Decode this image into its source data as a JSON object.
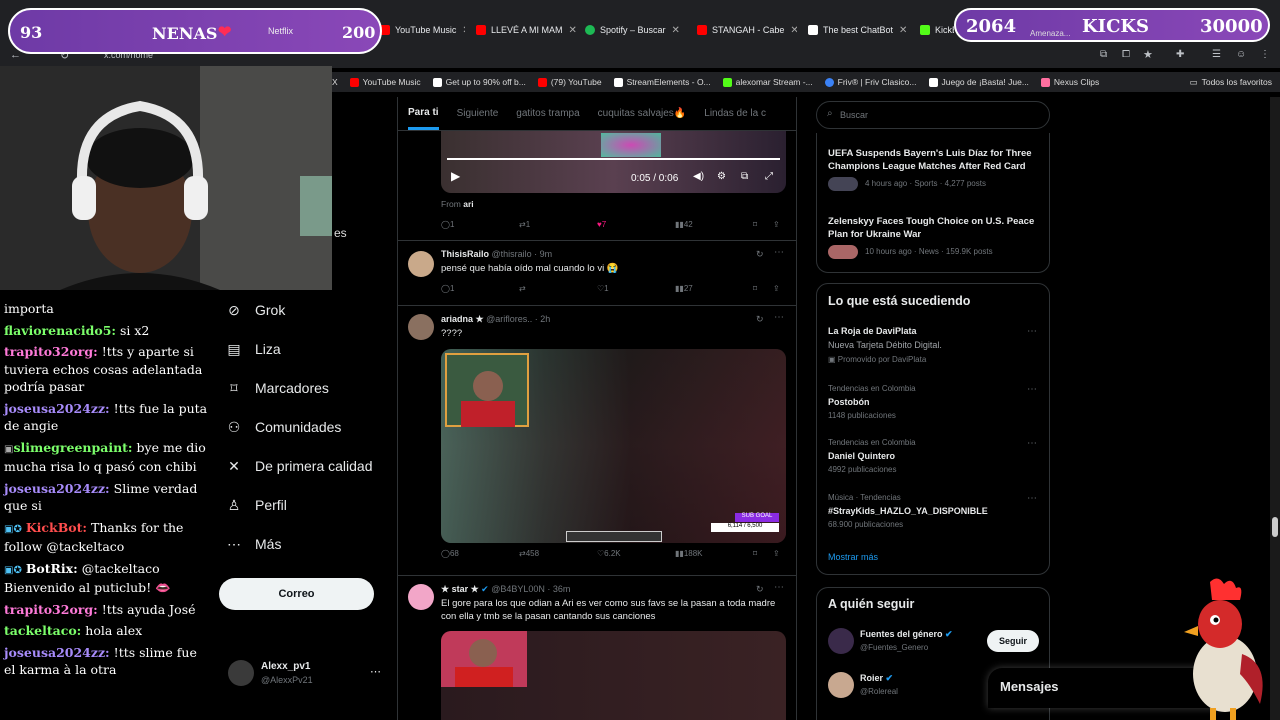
{
  "overlay_left": {
    "num": "93",
    "label": "NENAS",
    "tab_text": "Netflix",
    "count": "200"
  },
  "overlay_right": {
    "num": "2064",
    "label": "KICKS",
    "goal": "30000",
    "tab_text": "Amenaza..."
  },
  "tabs": [
    {
      "label": "YouTube Music",
      "color": "#ff0000"
    },
    {
      "label": "LLEVÉ A MI MAM",
      "color": "#ff0000"
    },
    {
      "label": "Spotify – Buscar",
      "color": "#1db954"
    },
    {
      "label": "STANGAH - Cabe",
      "color": "#ff0000"
    },
    {
      "label": "The best ChatBot",
      "color": "#ffffff"
    },
    {
      "label": "KickB",
      "color": "#53fc18"
    }
  ],
  "url": "x.com/home",
  "bookmarks": [
    {
      "label": "X",
      "color": "#fff"
    },
    {
      "label": "YouTube Music",
      "color": "#ff0000"
    },
    {
      "label": "Get up to 90% off b...",
      "color": "#ffffff"
    },
    {
      "label": "(79) YouTube",
      "color": "#ff0000"
    },
    {
      "label": "StreamElements - O...",
      "color": "#ffffff"
    },
    {
      "label": "alexomar Stream -...",
      "color": "#53fc18"
    },
    {
      "label": "Friv® | Friv Clasico...",
      "color": "#3b82f6"
    },
    {
      "label": "Juego de ¡Basta! Jue...",
      "color": "#ffffff"
    },
    {
      "label": "Nexus Clips",
      "color": "#ff6fa0"
    }
  ],
  "bookmarks_all": "Todos los favoritos",
  "webcam_side_text": "es",
  "chat": [
    {
      "user": "",
      "text": "importa",
      "color": "#ffffff"
    },
    {
      "user": "flaviorenacido5:",
      "text": "si x2",
      "color": "#7cff6b"
    },
    {
      "user": "trapito32org:",
      "text": "!tts y aparte si tuviera echos cosas adelantada podría pasar",
      "color": "#ff7ad9"
    },
    {
      "user": "joseusa2024zz:",
      "text": "!tts fue la puta de angie",
      "color": "#a78bfa"
    },
    {
      "user": "slimegreenpaint:",
      "text": "bye me dio mucha risa lo q pasó con chibi",
      "color": "#7cff6b"
    },
    {
      "user": "joseusa2024zz:",
      "text": "Slime verdad que si",
      "color": "#a78bfa"
    },
    {
      "user": "KickBot:",
      "text": "Thanks for the follow @tackeltaco",
      "color": "#ff4d4d"
    },
    {
      "user": "BotRix:",
      "text": "@tackeltaco Bienvenido al puticlub! 👄",
      "color": "#ffffff"
    },
    {
      "user": "trapito32org:",
      "text": "!tts ayuda José",
      "color": "#ff7ad9"
    },
    {
      "user": "tackeltaco:",
      "text": "hola alex",
      "color": "#7cff6b"
    },
    {
      "user": "joseusa2024zz:",
      "text": "!tts slime fue el karma à la otra",
      "color": "#a78bfa"
    }
  ],
  "nav": [
    {
      "label": "Grok",
      "icon": "grok-icon",
      "glyph": "⊘"
    },
    {
      "label": "Liza",
      "icon": "list-icon",
      "glyph": "▤"
    },
    {
      "label": "Marcadores",
      "icon": "bookmark-icon",
      "glyph": "⌑"
    },
    {
      "label": "Comunidades",
      "icon": "communities-icon",
      "glyph": "⚇"
    },
    {
      "label": "De primera calidad",
      "icon": "x-premium-icon",
      "glyph": "✕"
    },
    {
      "label": "Perfil",
      "icon": "profile-icon",
      "glyph": "♙"
    },
    {
      "label": "Más",
      "icon": "more-icon",
      "glyph": "⋯"
    }
  ],
  "correo_label": "Correo",
  "account": {
    "name": "Alexx_pv1",
    "handle": "@AlexxPv21"
  },
  "feed_tabs": [
    "Para ti",
    "Siguiente",
    "gatitos trampa",
    "cuquitas salvajes🔥",
    "Lindas de la c"
  ],
  "tweet1": {
    "video_time": "0:05 / 0:06",
    "from": "From",
    "from_user": "ari",
    "replies": "1",
    "retweets": "1",
    "likes": "7",
    "views": "42"
  },
  "tweet2": {
    "name": "ThisisRailo",
    "handle": "@thisrailo · 9m",
    "text": "pensé que había oído mal cuando lo vi 😭",
    "replies": "1",
    "likes": "1",
    "views": "27"
  },
  "tweet3": {
    "name": "ariadna ★",
    "handle": "@ariflores.. · 2h",
    "text": "????",
    "replies": "68",
    "retweets": "458",
    "likes": "6.2K",
    "views": "188K",
    "subgoal": "SUB GOAL",
    "subgoal_value": "6,114 / 6,500"
  },
  "tweet4": {
    "name": "★ star ★",
    "handle": "@B4BYL00N · 36m",
    "text": "El gore para los que odian a Ari es ver como sus favs se la pasan a toda madre con ella y tmb se la pasan cantando sus canciones"
  },
  "search_placeholder": "Buscar",
  "news": [
    {
      "title": "UEFA Suspends Bayern's Luis Díaz for Three Champions League Matches After Red Card",
      "meta": "4 hours ago · Sports · 4,277 posts"
    },
    {
      "title": "Zelenskyy Faces Tough Choice on U.S. Peace Plan for Ukraine War",
      "meta": "10 hours ago · News · 159.9K posts"
    }
  ],
  "happening": {
    "title": "Lo que está sucediendo",
    "promo_title": "La Roja de DaviPlata",
    "promo_sub": "Nueva Tarjeta Débito Digital.",
    "promo_by": "Promovido por DaviPlata",
    "trends": [
      {
        "context": "Tendencias en Colombia",
        "name": "Postobón",
        "count": "1148 publicaciones"
      },
      {
        "context": "Tendencias en Colombia",
        "name": "Daniel Quintero",
        "count": "4992 publicaciones"
      },
      {
        "context": "Música · Tendencias",
        "name": "#StrayKids_HAZLO_YA_DISPONIBLE",
        "count": "68.900 publicaciones"
      }
    ],
    "show_more": "Mostrar más"
  },
  "follow": {
    "title": "A quién seguir",
    "items": [
      {
        "name": "Fuentes del género",
        "handle": "@Fuentes_Genero",
        "button": "Seguir"
      },
      {
        "name": "Roier",
        "handle": "@Rolereal",
        "button": ""
      }
    ]
  },
  "mensajes": "Mensajes",
  "colors": {
    "accent": "#1d9bf0",
    "bg": "#000000",
    "border": "#2f3336",
    "overlay": "#7a40b0"
  }
}
